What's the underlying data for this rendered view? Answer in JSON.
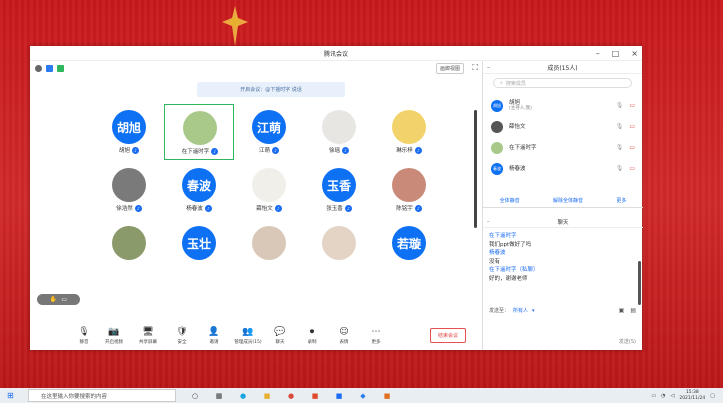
{
  "window": {
    "title": "腾讯会议",
    "view_btn": "画廊视图"
  },
  "notice": "开启会议：@下摇时字 说话",
  "tiles": [
    {
      "name": "胡旭",
      "text": "胡旭",
      "kind": "blue",
      "col": 0,
      "row": 0
    },
    {
      "name": "在下遥时字",
      "text": "",
      "kind": "img",
      "bg": "#a9c98a",
      "col": 1,
      "row": 0,
      "selected": true
    },
    {
      "name": "江萌",
      "text": "江萌",
      "kind": "blue",
      "col": 2,
      "row": 0
    },
    {
      "name": "徐瑶",
      "text": "",
      "kind": "img",
      "bg": "#e8e6e3",
      "col": 3,
      "row": 0
    },
    {
      "name": "琳乐梓",
      "text": "",
      "kind": "img",
      "bg": "#f2d36b",
      "col": 4,
      "row": 0
    },
    {
      "name": "徐浩然",
      "text": "",
      "kind": "img",
      "bg": "#7a7a7a",
      "col": 0,
      "row": 1
    },
    {
      "name": "杨春波",
      "text": "春波",
      "kind": "blue",
      "col": 1,
      "row": 1
    },
    {
      "name": "薛怡文",
      "text": "",
      "kind": "img",
      "bg": "#f0efe9",
      "col": 2,
      "row": 1
    },
    {
      "name": "张玉香",
      "text": "玉香",
      "kind": "blue",
      "col": 3,
      "row": 1
    },
    {
      "name": "陈铭宇",
      "text": "",
      "kind": "img",
      "bg": "#c98a7a",
      "col": 4,
      "row": 1
    },
    {
      "name": "",
      "text": "",
      "kind": "img",
      "bg": "#8a9a6a",
      "col": 0,
      "row": 2
    },
    {
      "name": "",
      "text": "玉壮",
      "kind": "blue",
      "col": 1,
      "row": 2
    },
    {
      "name": "",
      "text": "",
      "kind": "img",
      "bg": "#d9c8b8",
      "col": 2,
      "row": 2
    },
    {
      "name": "",
      "text": "",
      "kind": "img",
      "bg": "#e3d4c6",
      "col": 3,
      "row": 2
    },
    {
      "name": "",
      "text": "若璇",
      "kind": "blue",
      "col": 4,
      "row": 2
    }
  ],
  "toolbar": [
    {
      "label": "静音",
      "icon": "mic-icon",
      "glyph": "🎙"
    },
    {
      "label": "开启视频",
      "icon": "camera-off-icon",
      "glyph": "📷"
    },
    {
      "label": "共享屏幕",
      "icon": "share-screen-icon",
      "glyph": "🖥"
    },
    {
      "label": "安全",
      "icon": "shield-icon",
      "glyph": "🛡"
    },
    {
      "label": "邀请",
      "icon": "invite-icon",
      "glyph": "👤"
    },
    {
      "label": "管理成员(15)",
      "icon": "members-icon",
      "glyph": "👥"
    },
    {
      "label": "聊天",
      "icon": "chat-icon",
      "glyph": "💬"
    },
    {
      "label": "录制",
      "icon": "record-icon",
      "glyph": "⏺"
    },
    {
      "label": "表情",
      "icon": "emoji-icon",
      "glyph": "☺"
    },
    {
      "label": "更多",
      "icon": "more-icon",
      "glyph": "⋯"
    }
  ],
  "leave_label": "结束会议",
  "panel": {
    "title": "成员(15人)",
    "search_placeholder": "搜索成员",
    "members": [
      {
        "name": "胡旭",
        "sub": "(主持人,我)",
        "avatar_text": "胡旭",
        "bg": "#0e70f2"
      },
      {
        "name": "薛怡文",
        "sub": "",
        "avatar_text": "",
        "bg": "#555"
      },
      {
        "name": "在下遥时字",
        "sub": "",
        "avatar_text": "",
        "bg": "#a9c98a"
      },
      {
        "name": "杨春波",
        "sub": "",
        "avatar_text": "春波",
        "bg": "#0e70f2"
      }
    ],
    "buttons": [
      "全体静音",
      "解除全体静音",
      "更多"
    ]
  },
  "chat": {
    "title": "聊天",
    "messages": [
      {
        "text": "在下遥时字",
        "kind": "name"
      },
      {
        "text": "我们ppt做好了吗",
        "kind": "text"
      },
      {
        "text": "杨春波",
        "kind": "name"
      },
      {
        "text": "没有",
        "kind": "text"
      },
      {
        "text": "在下遥时字（私聊）",
        "kind": "name"
      },
      {
        "text": "好的，谢谢老师",
        "kind": "text"
      }
    ],
    "send_to_label": "发送至：",
    "send_to_value": "所有人",
    "send_label": "发送(S)"
  },
  "taskbar": {
    "search_placeholder": "在这里输入你要搜索的内容",
    "time": "15:38",
    "date": "2021/11/24"
  }
}
